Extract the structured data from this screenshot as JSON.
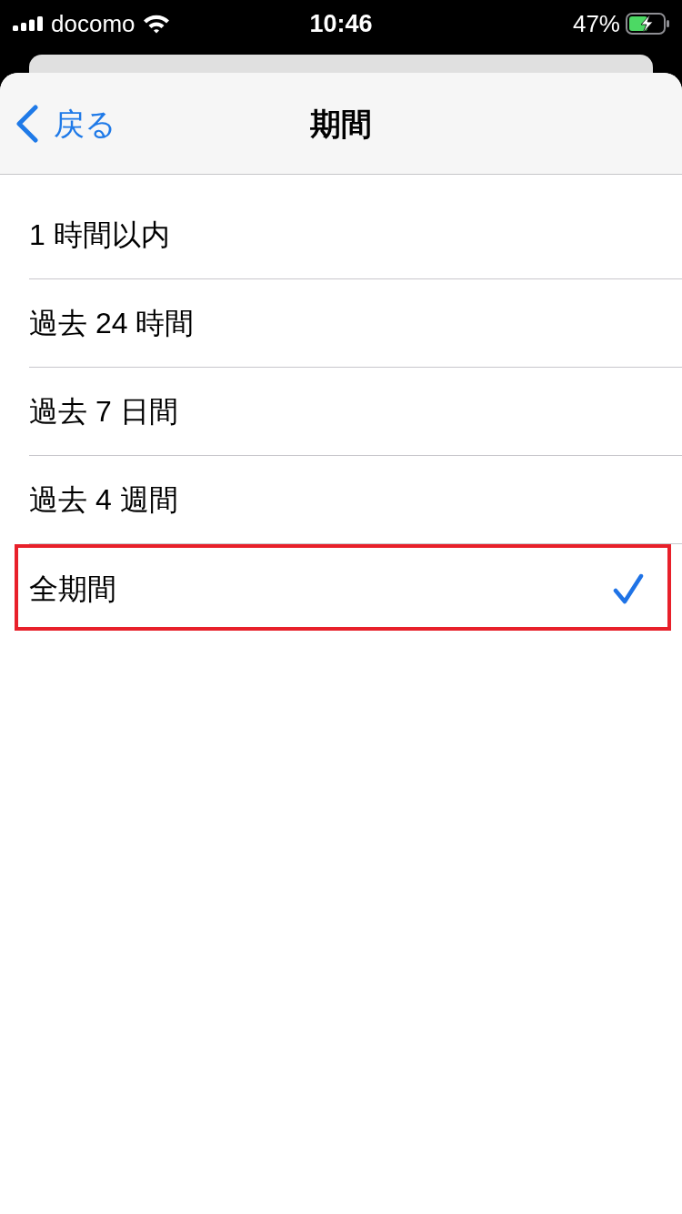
{
  "status_bar": {
    "carrier": "docomo",
    "time": "10:46",
    "battery": "47%",
    "charging": true
  },
  "nav_bar": {
    "back": "戻る",
    "title": "期間"
  },
  "options": [
    {
      "label": "1 時間以内",
      "selected": false,
      "highlighted": false
    },
    {
      "label": "過去 24 時間",
      "selected": false,
      "highlighted": false
    },
    {
      "label": "過去 7 日間",
      "selected": false,
      "highlighted": false
    },
    {
      "label": "過去 4 週間",
      "selected": false,
      "highlighted": false
    },
    {
      "label": "全期間",
      "selected": true,
      "highlighted": true
    }
  ]
}
